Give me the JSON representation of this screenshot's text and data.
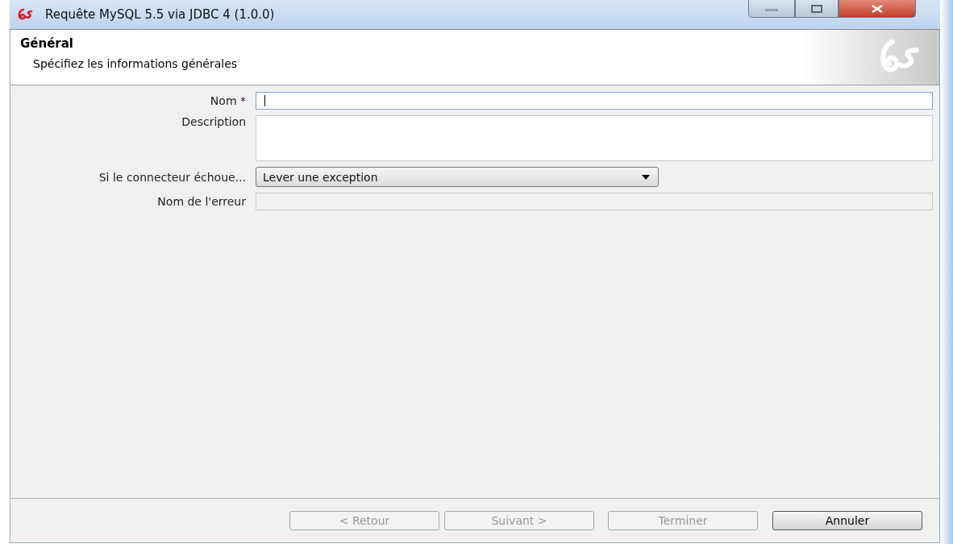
{
  "window": {
    "title": "Requête MySQL 5.5 via JDBC 4 (1.0.0)"
  },
  "header": {
    "title": "Général",
    "subtitle": "Spécifiez les informations générales"
  },
  "fields": [
    {
      "kind": "text",
      "label": "Nom *",
      "focused": true,
      "disabled": false
    },
    {
      "kind": "textarea",
      "label": "Description",
      "focused": false,
      "disabled": false
    },
    {
      "kind": "dropdown",
      "label": "Si le connecteur échoue...",
      "value": "Lever une exception"
    },
    {
      "kind": "text",
      "label": "Nom de l'erreur",
      "focused": false,
      "disabled": true
    }
  ],
  "buttons": [
    {
      "label": "< Retour",
      "disabled": true
    },
    {
      "label": "Suivant >",
      "disabled": true
    },
    {
      "label": "Terminer",
      "disabled": true
    },
    {
      "label": "Annuler",
      "disabled": false
    }
  ]
}
